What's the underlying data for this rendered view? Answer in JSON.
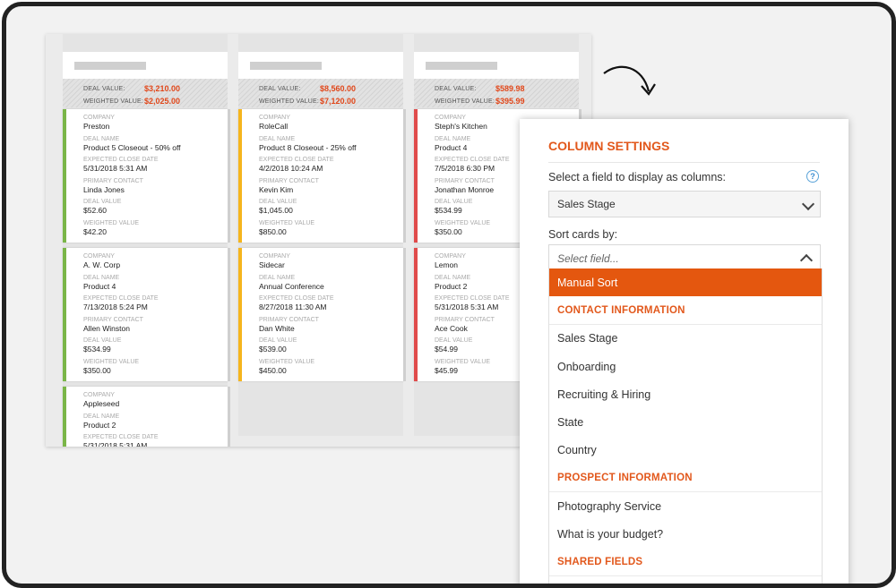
{
  "board": {
    "columns": [
      {
        "summary": {
          "deal_label": "DEAL VALUE:",
          "deal_value": "$3,210.00",
          "weighted_label": "WEIGHTED VALUE:",
          "weighted_value": "$2,025.00"
        },
        "cards": [
          {
            "color": "green",
            "company": "Preston",
            "deal_name": "Product 5 Closeout - 50% off",
            "close_date": "5/31/2018 5:31 AM",
            "contact": "Linda Jones",
            "deal_value": "$52.60",
            "weighted_value": "$42.20"
          },
          {
            "color": "green",
            "company": "A. W. Corp",
            "deal_name": "Product 4",
            "close_date": "7/13/2018 5:24 PM",
            "contact": "Allen Winston",
            "deal_value": "$534.99",
            "weighted_value": "$350.00"
          },
          {
            "color": "green",
            "company": "Appleseed",
            "deal_name": "Product 2",
            "close_date": "5/31/2018 5:31 AM",
            "contact": "",
            "deal_value": "",
            "weighted_value": ""
          }
        ]
      },
      {
        "summary": {
          "deal_label": "DEAL VALUE:",
          "deal_value": "$8,560.00",
          "weighted_label": "WEIGHTED VALUE:",
          "weighted_value": "$7,120.00"
        },
        "cards": [
          {
            "color": "orange",
            "company": "RoleCall",
            "deal_name": "Product 8 Closeout - 25% off",
            "close_date": "4/2/2018 10:24 AM",
            "contact": "Kevin Kim",
            "deal_value": "$1,045.00",
            "weighted_value": "$850.00"
          },
          {
            "color": "orange",
            "company": "Sidecar",
            "deal_name": "Annual Conference",
            "close_date": "8/27/2018 11:30 AM",
            "contact": "Dan White",
            "deal_value": "$539.00",
            "weighted_value": "$450.00"
          }
        ]
      },
      {
        "summary": {
          "deal_label": "DEAL VALUE:",
          "deal_value": "$589.98",
          "weighted_label": "WEIGHTED VALUE:",
          "weighted_value": "$395.99"
        },
        "cards": [
          {
            "color": "red",
            "company": "Steph's Kitchen",
            "deal_name": "Product 4",
            "close_date": "7/5/2018 6:30 PM",
            "contact": "Jonathan Monroe",
            "deal_value": "$534.99",
            "weighted_value": "$350.00"
          },
          {
            "color": "red",
            "company": "Lemon",
            "deal_name": "Product 2",
            "close_date": "5/31/2018 5:31 AM",
            "contact": "Ace Cook",
            "deal_value": "$54.99",
            "weighted_value": "$45.99"
          }
        ]
      }
    ],
    "field_labels": {
      "company": "COMPANY",
      "deal_name": "DEAL NAME",
      "close_date": "EXPECTED CLOSE DATE",
      "contact": "PRIMARY CONTACT",
      "deal_value": "DEAL VALUE",
      "weighted_value": "WEIGHTED VALUE"
    }
  },
  "panel": {
    "title": "COLUMN SETTINGS",
    "columns_field_label": "Select a field to display as columns:",
    "help_icon": "?",
    "columns_field_value": "Sales Stage",
    "sort_label": "Sort cards by:",
    "sort_placeholder": "Select field...",
    "dropdown_items": [
      {
        "label": "Manual Sort",
        "type": "active"
      },
      {
        "label": "CONTACT INFORMATION",
        "type": "group"
      },
      {
        "label": "Sales Stage",
        "type": "option"
      },
      {
        "label": "Onboarding",
        "type": "option"
      },
      {
        "label": "Recruiting & Hiring",
        "type": "option"
      },
      {
        "label": "State",
        "type": "option"
      },
      {
        "label": "Country",
        "type": "option"
      },
      {
        "label": "PROSPECT INFORMATION",
        "type": "group"
      },
      {
        "label": "Photography Service",
        "type": "option"
      },
      {
        "label": "What is your budget?",
        "type": "option"
      },
      {
        "label": "SHARED FIELDS",
        "type": "group"
      }
    ]
  },
  "colors": {
    "accent": "#e2581c",
    "active_item": "#e4570f",
    "green": "#7ab648",
    "orange": "#f5b51e",
    "red": "#e04b4b"
  }
}
